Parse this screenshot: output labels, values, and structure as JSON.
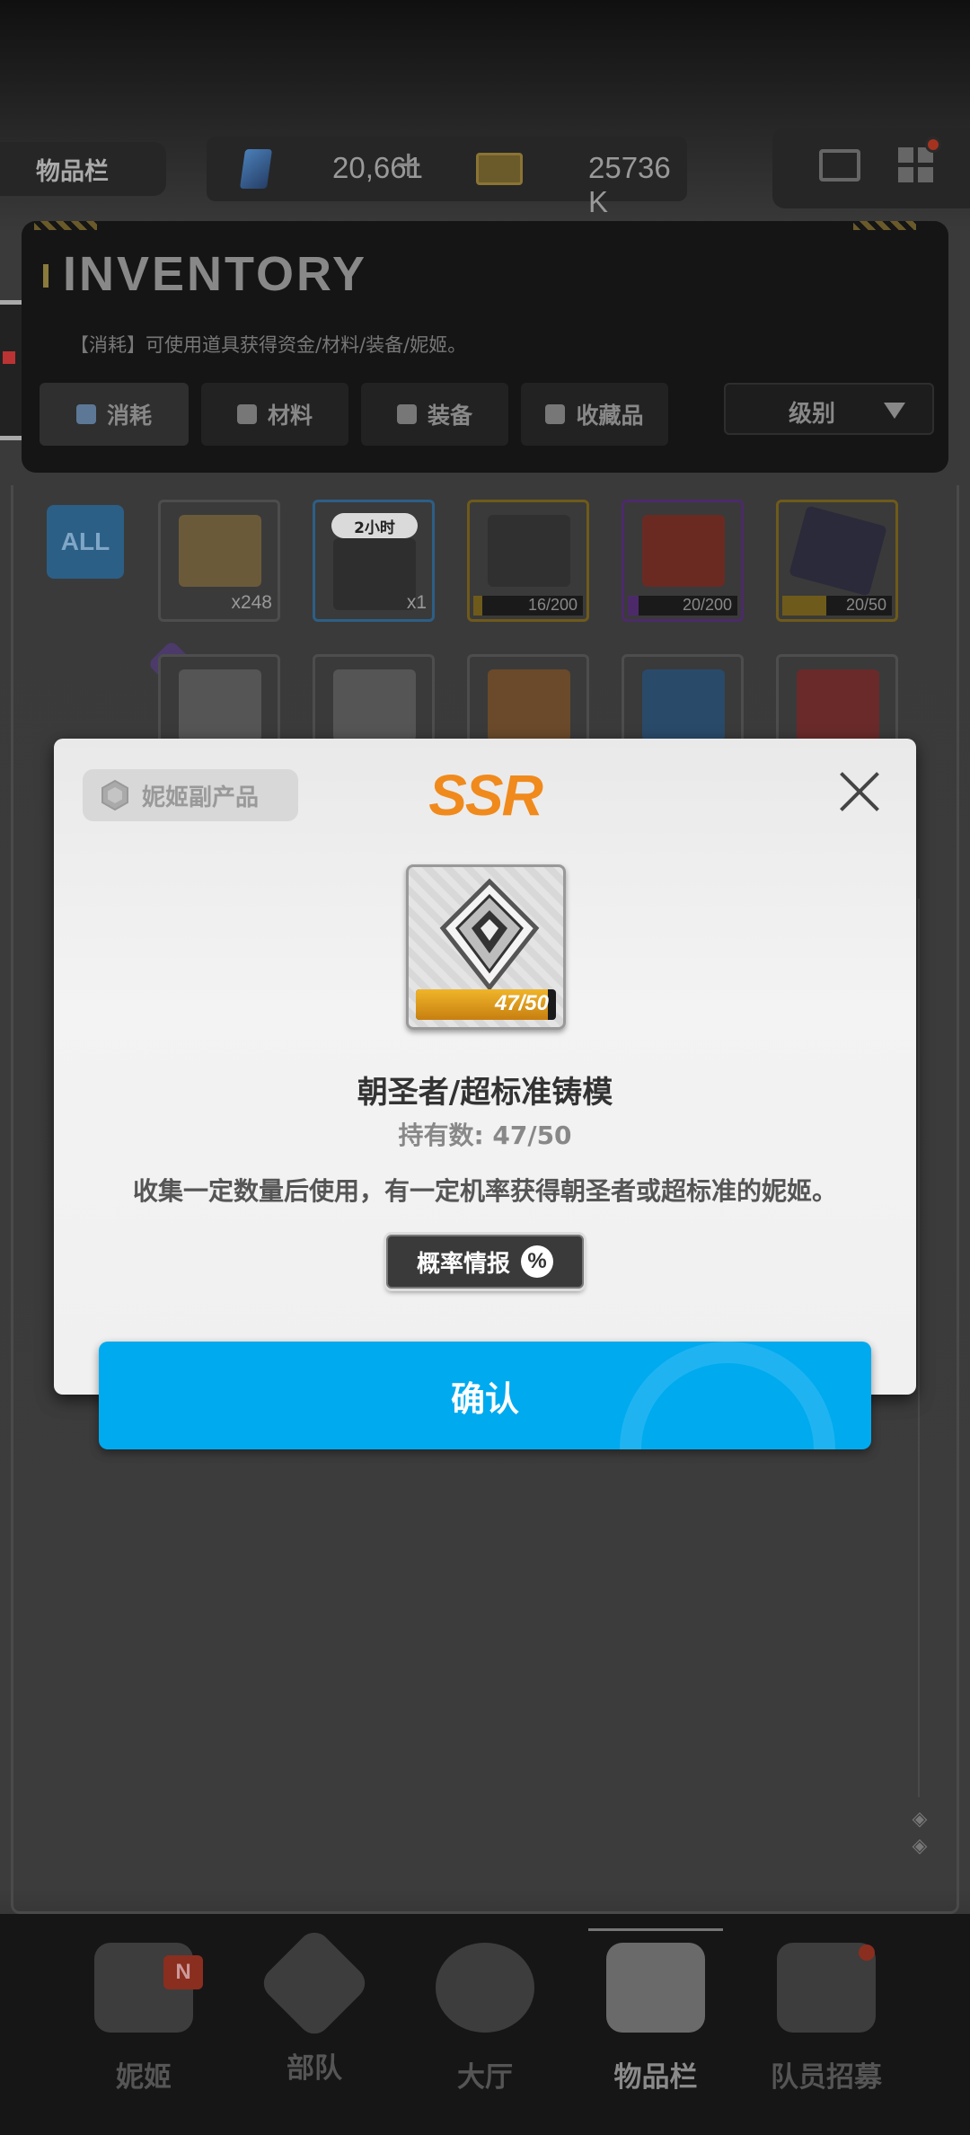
{
  "topbar": {
    "section_label": "物品栏",
    "gems": "20,661",
    "gems_plus": "+",
    "credits": "25736 K"
  },
  "inventory": {
    "title": "INVENTORY",
    "description": "【消耗】可使用道具获得资金/材料/装备/妮姬。",
    "tabs": [
      {
        "label": "消耗",
        "active": true
      },
      {
        "label": "材料"
      },
      {
        "label": "装备"
      },
      {
        "label": "收藏品"
      }
    ],
    "sort_label": "级别",
    "filter_all": "ALL",
    "items": [
      {
        "count": "x248"
      },
      {
        "tag": "2小时",
        "count": "x1"
      },
      {
        "progress_text": "16/200",
        "progress": 0.08
      },
      {
        "progress_text": "20/200",
        "progress": 0.1
      },
      {
        "progress_text": "20/50",
        "progress": 0.4
      }
    ]
  },
  "modal": {
    "category": "妮姬副产品",
    "rarity": "SSR",
    "item_name": "朝圣者/超标准铸模",
    "owned": "持有数: 47/50",
    "progress_text": "47/50",
    "progress": 0.94,
    "description": "收集一定数量后使用，有一定机率获得朝圣者或超标准的妮姬。",
    "prob_button": "概率情报",
    "prob_icon": "%",
    "confirm": "确认"
  },
  "bottom_nav": {
    "items": [
      {
        "label": "妮姬",
        "badge": "N"
      },
      {
        "label": "部队"
      },
      {
        "label": "大厅"
      },
      {
        "label": "物品栏",
        "active": true
      },
      {
        "label": "队员招募"
      }
    ]
  },
  "colors": {
    "accent_blue": "#00aaef",
    "rarity_orange": "#f08a1c"
  }
}
